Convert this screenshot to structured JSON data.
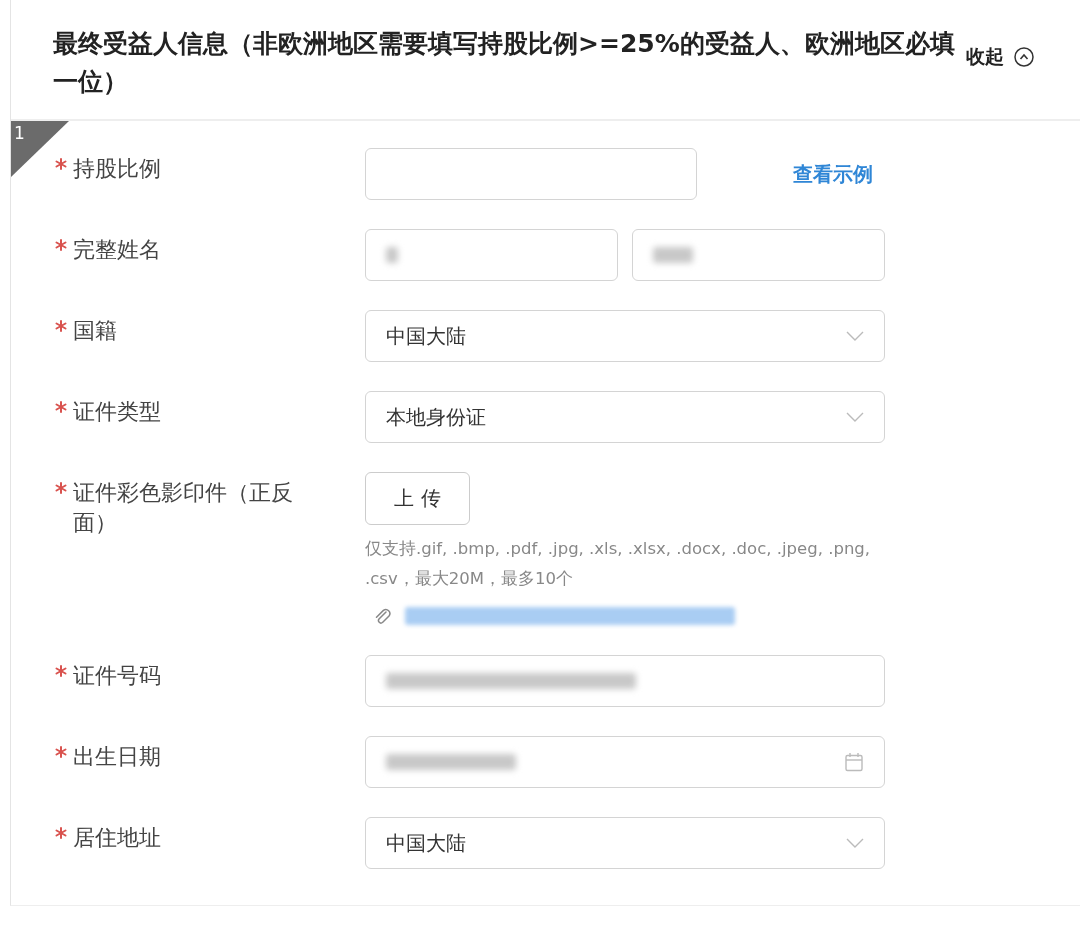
{
  "section": {
    "title": "最终受益人信息（非欧洲地区需要填写持股比例>=25%的受益人、欧洲地区必填一位）",
    "collapse": "收起",
    "expanded": true
  },
  "entry": {
    "index": "1",
    "fields": [
      {
        "kind": "input",
        "label": "持股比例",
        "required": true,
        "link": "查看示例"
      },
      {
        "kind": "name",
        "label": "完整姓名",
        "required": true,
        "inputs": [
          {
            "redacted": true
          },
          {
            "redacted": true
          }
        ]
      },
      {
        "kind": "select",
        "label": "国籍",
        "required": true,
        "value": "中国大陆"
      },
      {
        "kind": "select",
        "label": "证件类型",
        "required": true,
        "value": "本地身份证"
      },
      {
        "kind": "upload",
        "label": "证件彩色影印件（正反面）",
        "required": true,
        "button": "上 传",
        "hint": "仅支持.gif, .bmp, .pdf, .jpg, .xls, .xlsx, .docx, .doc, .jpeg, .png, .csv，最大20M，最多10个",
        "files": [
          {
            "redacted": true
          }
        ]
      },
      {
        "kind": "input",
        "label": "证件号码",
        "required": true,
        "redacted": true
      },
      {
        "kind": "date",
        "label": "出生日期",
        "required": true,
        "redacted": true
      },
      {
        "kind": "select",
        "label": "居住地址",
        "required": true,
        "value": "中国大陆"
      }
    ]
  }
}
